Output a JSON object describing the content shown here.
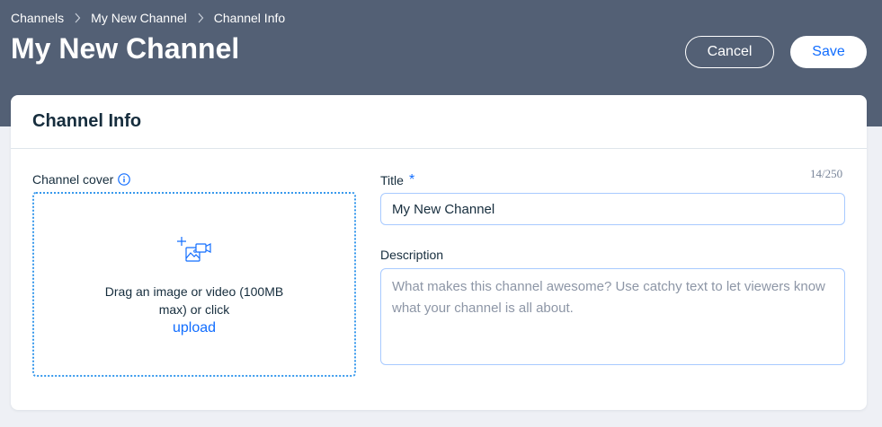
{
  "breadcrumb": {
    "items": [
      {
        "label": "Channels"
      },
      {
        "label": "My New Channel"
      },
      {
        "label": "Channel Info"
      }
    ]
  },
  "header": {
    "title": "My New Channel",
    "cancel_label": "Cancel",
    "save_label": "Save"
  },
  "card": {
    "title": "Channel Info"
  },
  "cover": {
    "label": "Channel cover",
    "info_icon": "info-icon",
    "upload_icon": "add-media-icon",
    "drop_text": "Drag an image or video (100MB max) or click",
    "upload_link": "upload"
  },
  "title_field": {
    "label": "Title",
    "required_mark": "*",
    "value": "My New Channel",
    "counter": "14/250"
  },
  "description_field": {
    "label": "Description",
    "value": "",
    "placeholder": "What makes this channel awesome? Use catchy text to let viewers know what your channel is all about."
  },
  "colors": {
    "header_bg": "#536075",
    "accent": "#116dff",
    "page_bg": "#eef0f5",
    "text": "#162d3d"
  }
}
